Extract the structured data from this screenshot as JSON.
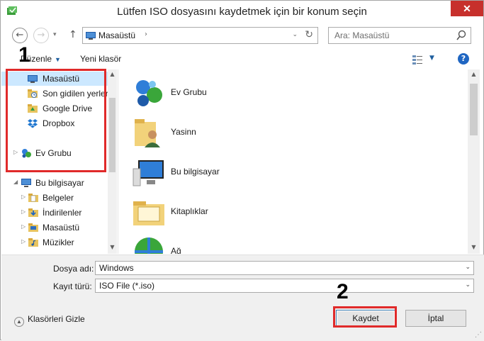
{
  "window": {
    "title": "Lütfen ISO dosyasını kaydetmek için bir konum seçin",
    "close_glyph": "✕"
  },
  "nav": {
    "back_glyph": "←",
    "forward_glyph": "→",
    "recent_glyph": "▾",
    "up_glyph": "↑"
  },
  "address": {
    "current": "Masaüstü",
    "chevron": "›",
    "dropdown": "⌄",
    "refresh": "↻"
  },
  "search": {
    "placeholder": "Ara: Masaüstü"
  },
  "toolbar": {
    "organize_label": "Düzenle",
    "organize_arrow": "▼",
    "new_folder_label": "Yeni klasör",
    "view_arrow": "▼",
    "help_glyph": "?"
  },
  "sidebar": {
    "favorites": [
      {
        "label": "Masaüstü",
        "icon": "desktop-icon",
        "selected": true
      },
      {
        "label": "Son gidilen yerler",
        "icon": "recent-places-icon"
      },
      {
        "label": "Google Drive",
        "icon": "google-drive-icon"
      },
      {
        "label": "Dropbox",
        "icon": "dropbox-icon"
      }
    ],
    "homegroup": {
      "label": "Ev Grubu",
      "icon": "homegroup-icon",
      "expander": "▷"
    },
    "computer": {
      "label": "Bu bilgisayar",
      "icon": "computer-icon",
      "expander": "◢"
    },
    "computer_children": [
      {
        "label": "Belgeler",
        "icon": "documents-folder-icon",
        "expander": "▷"
      },
      {
        "label": "İndirilenler",
        "icon": "downloads-folder-icon",
        "expander": "▷"
      },
      {
        "label": "Masaüstü",
        "icon": "desktop-folder-icon",
        "expander": "▷"
      },
      {
        "label": "Müzikler",
        "icon": "music-folder-icon",
        "expander": "▷"
      }
    ]
  },
  "content": {
    "items": [
      {
        "label": "Ev Grubu",
        "icon": "homegroup-icon"
      },
      {
        "label": "Yasinn",
        "icon": "user-folder-icon"
      },
      {
        "label": "Bu bilgisayar",
        "icon": "computer-icon"
      },
      {
        "label": "Kitaplıklar",
        "icon": "libraries-icon"
      },
      {
        "label": "Ağ",
        "icon": "network-icon"
      }
    ]
  },
  "form": {
    "filename_label": "Dosya adı:",
    "filename_value": "Windows",
    "filetype_label": "Kayıt türü:",
    "filetype_value": "ISO File (*.iso)",
    "dropdown_glyph": "⌄"
  },
  "footer": {
    "hide_folders_label": "Klasörleri Gizle",
    "hide_glyph": "▲",
    "save_label": "Kaydet",
    "cancel_label": "İptal"
  },
  "annotations": {
    "callout_1": "1",
    "callout_2": "2"
  },
  "colors": {
    "highlight_red": "#e02a2a",
    "selection_blue": "#cce8ff",
    "close_red": "#c7302c"
  }
}
